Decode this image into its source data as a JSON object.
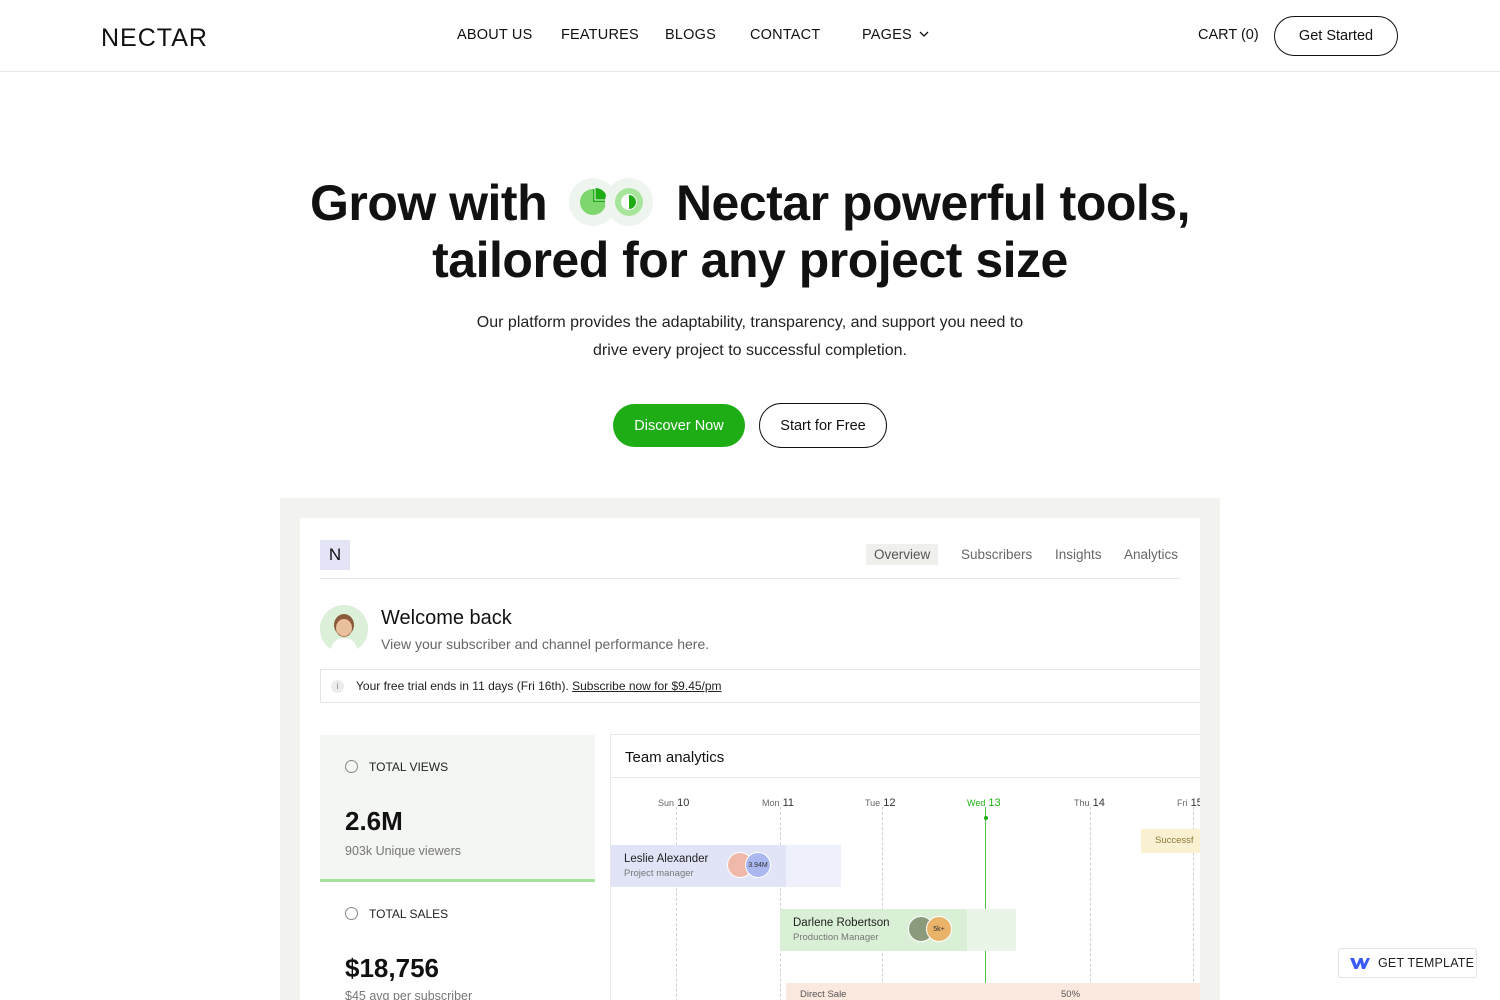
{
  "header": {
    "logo": "NECTAR",
    "nav": [
      "ABOUT US",
      "FEATURES",
      "BLOGS",
      "CONTACT",
      "PAGES"
    ],
    "cart": "CART (0)",
    "cta": "Get Started"
  },
  "hero": {
    "title_part1": "Grow with",
    "title_part2": "Nectar powerful tools,",
    "title_line2": "tailored for any project size",
    "subtitle_line1": "Our platform provides the adaptability, transparency, and support you need to",
    "subtitle_line2": "drive every project to successful completion.",
    "primary_button": "Discover Now",
    "secondary_button": "Start for Free"
  },
  "dashboard": {
    "logo_letter": "N",
    "tabs": [
      "Overview",
      "Subscribers",
      "Insights",
      "Analytics"
    ],
    "active_tab": "Overview",
    "welcome_title": "Welcome back",
    "welcome_subtitle": "View your subscriber and channel performance here.",
    "trial_icon": "i",
    "trial_text": "Your free trial ends in 11 days (Fri 16th).",
    "trial_link": "Subscribe now for $9.45/pm",
    "cards": [
      {
        "label": "TOTAL VIEWS",
        "value": "2.6M",
        "sub": "903k Unique viewers"
      },
      {
        "label": "TOTAL SALES",
        "value": "$18,756",
        "sub": "$45 avg per subscriber"
      }
    ],
    "team": {
      "title": "Team analytics",
      "days": [
        {
          "dow": "Sun",
          "num": "10"
        },
        {
          "dow": "Mon",
          "num": "11"
        },
        {
          "dow": "Tue",
          "num": "12"
        },
        {
          "dow": "Wed",
          "num": "13"
        },
        {
          "dow": "Thu",
          "num": "14"
        },
        {
          "dow": "Fri",
          "num": "15"
        }
      ],
      "rows": [
        {
          "name": "Leslie Alexander",
          "role": "Project manager",
          "badge": "3.94M"
        },
        {
          "name": "Darlene Robertson",
          "role": "Production Manager",
          "badge": "5k+"
        }
      ],
      "success_label": "Successf",
      "direct_label": "Direct Sale",
      "direct_pct": "50%"
    }
  },
  "badge": {
    "label": "GET TEMPLATE"
  },
  "colors": {
    "accent": "#1fad16",
    "text": "#111111"
  }
}
